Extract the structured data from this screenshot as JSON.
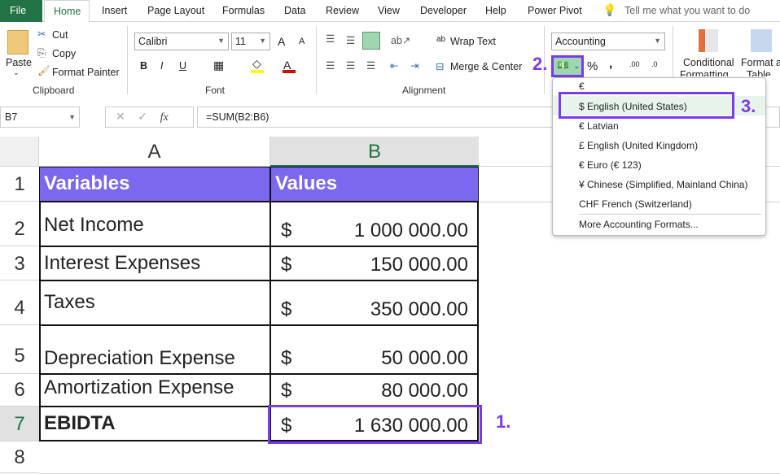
{
  "tabs": [
    "File",
    "Home",
    "Insert",
    "Page Layout",
    "Formulas",
    "Data",
    "Review",
    "View",
    "Developer",
    "Help",
    "Power Pivot"
  ],
  "tell_me": "Tell me what you want to do",
  "clipboard": {
    "paste": "Paste",
    "cut": "Cut",
    "copy": "Copy",
    "format_painter": "Format Painter",
    "group": "Clipboard"
  },
  "font": {
    "name": "Calibri",
    "size": "11",
    "group": "Font",
    "bold": "B",
    "italic": "I",
    "underline": "U",
    "grow": "A",
    "shrink": "A",
    "font_color": "A",
    "fill_color": "#ffff00",
    "font_color_hex": "#e00000"
  },
  "alignment": {
    "wrap": "Wrap Text",
    "merge": "Merge & Center",
    "group": "Alignment"
  },
  "number": {
    "format": "Accounting",
    "percent": "%",
    "comma": ",",
    "inc_dec": ".00",
    "dec_dec": ".0"
  },
  "styles": {
    "conditional": "Conditional",
    "conditional2": "Formatting",
    "format_table": "Format as",
    "format_table2": "Table"
  },
  "formula_bar": {
    "name_box": "B7",
    "fx": "fx",
    "formula": "=SUM(B2:B6)"
  },
  "columns": [
    "A",
    "B"
  ],
  "rows": [
    "1",
    "2",
    "3",
    "4",
    "5",
    "6",
    "7",
    "8"
  ],
  "table": {
    "header": [
      "Variables",
      "Values"
    ],
    "rows": [
      {
        "label": "Net Income",
        "cur": "$",
        "value": "1 000 000.00"
      },
      {
        "label": "Interest Expenses",
        "cur": "$",
        "value": "150 000.00"
      },
      {
        "label": "Taxes",
        "cur": "$",
        "value": "350 000.00"
      },
      {
        "label": "Depreciation Expense",
        "cur": "$",
        "value": "50 000.00"
      },
      {
        "label": "Amortization Expense",
        "cur": "$",
        "value": "80 000.00"
      },
      {
        "label": "EBIDTA",
        "cur": "$",
        "value": "1 630 000.00"
      }
    ],
    "header_color": "#7b68ee"
  },
  "dropdown": {
    "items": [
      "€",
      "$ English (United States)",
      "€ Latvian",
      "£ English (United Kingdom)",
      "€ Euro (€ 123)",
      "¥ Chinese (Simplified, Mainland China)",
      "CHF French (Switzerland)"
    ],
    "more": "More Accounting Formats..."
  },
  "annotations": [
    "1.",
    "2.",
    "3."
  ],
  "accent": "#7c3aed"
}
